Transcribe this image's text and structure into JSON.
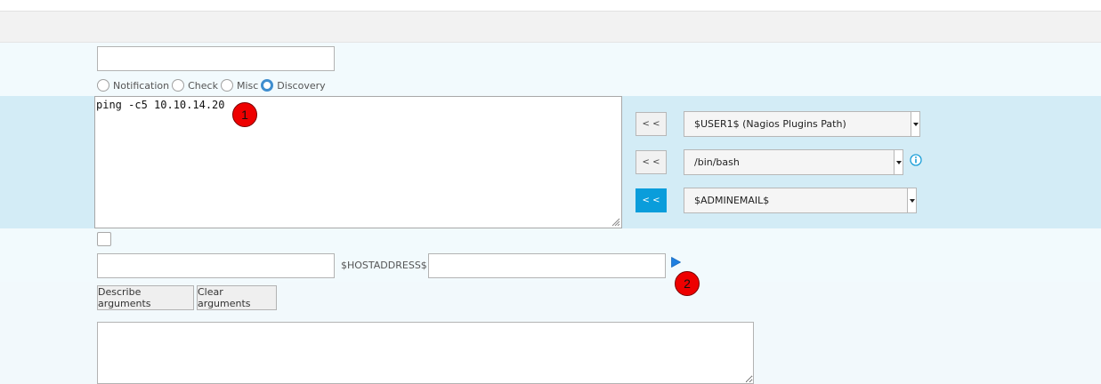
{
  "form": {
    "name_value": "",
    "command_type": {
      "options": [
        "Notification",
        "Check",
        "Misc",
        "Discovery"
      ],
      "selected": "Discovery"
    },
    "command_line": "ping -c5 10.10.14.20",
    "macro_panel": {
      "add_label": "< <",
      "selects": [
        {
          "value": "$USER1$ (Nagios Plugins Path)"
        },
        {
          "value": "/bin/bash"
        },
        {
          "value": "$ADMINEMAIL$"
        }
      ]
    },
    "enabled_checked": false,
    "args_value": "",
    "hostaddress_label": "$HOSTADDRESS$",
    "hostaddress_value": "",
    "describe_label": "Describe arguments",
    "clear_label": "Clear arguments",
    "description_value": ""
  },
  "annotations": {
    "badge1": "1",
    "badge2": "2"
  },
  "colors": {
    "accent": "#0a9ddb",
    "radio_checked": "#3f8ecf",
    "badge": "#ee0000",
    "row_highlight": "#d3ecf6",
    "play": "#1f7fe0"
  },
  "icons": {
    "info": "info-icon",
    "play": "play-icon",
    "dropdown": "chevron-down-icon",
    "resize": "resize-grip-icon"
  }
}
